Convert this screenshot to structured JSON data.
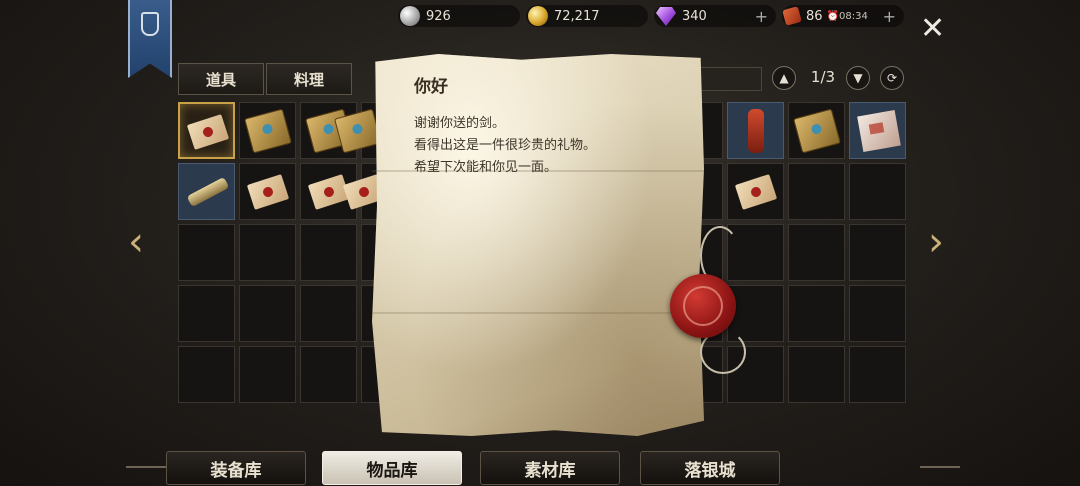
{
  "currencies": {
    "silver": {
      "value": "926"
    },
    "gold": {
      "value": "72,217"
    },
    "gem": {
      "value": "340"
    },
    "ticket": {
      "value": "86",
      "timer": "⏰08:34"
    }
  },
  "tabs": [
    {
      "label": "道具"
    },
    {
      "label": "料理"
    }
  ],
  "pager": {
    "indicator": "1/3"
  },
  "letter": {
    "title": "你好",
    "lines": [
      "谢谢你送的剑。",
      "看得出这是一件很珍贵的礼物。",
      "希望下次能和你见一面。"
    ]
  },
  "bottom_nav": [
    {
      "label": "装备库"
    },
    {
      "label": "物品库"
    },
    {
      "label": "素材库"
    },
    {
      "label": "落银城"
    }
  ],
  "colors": {
    "gold_accent": "#c9a248",
    "banner_blue": "#2f5283",
    "wax_red": "#a5201a",
    "parchment": "#d8ccae"
  }
}
